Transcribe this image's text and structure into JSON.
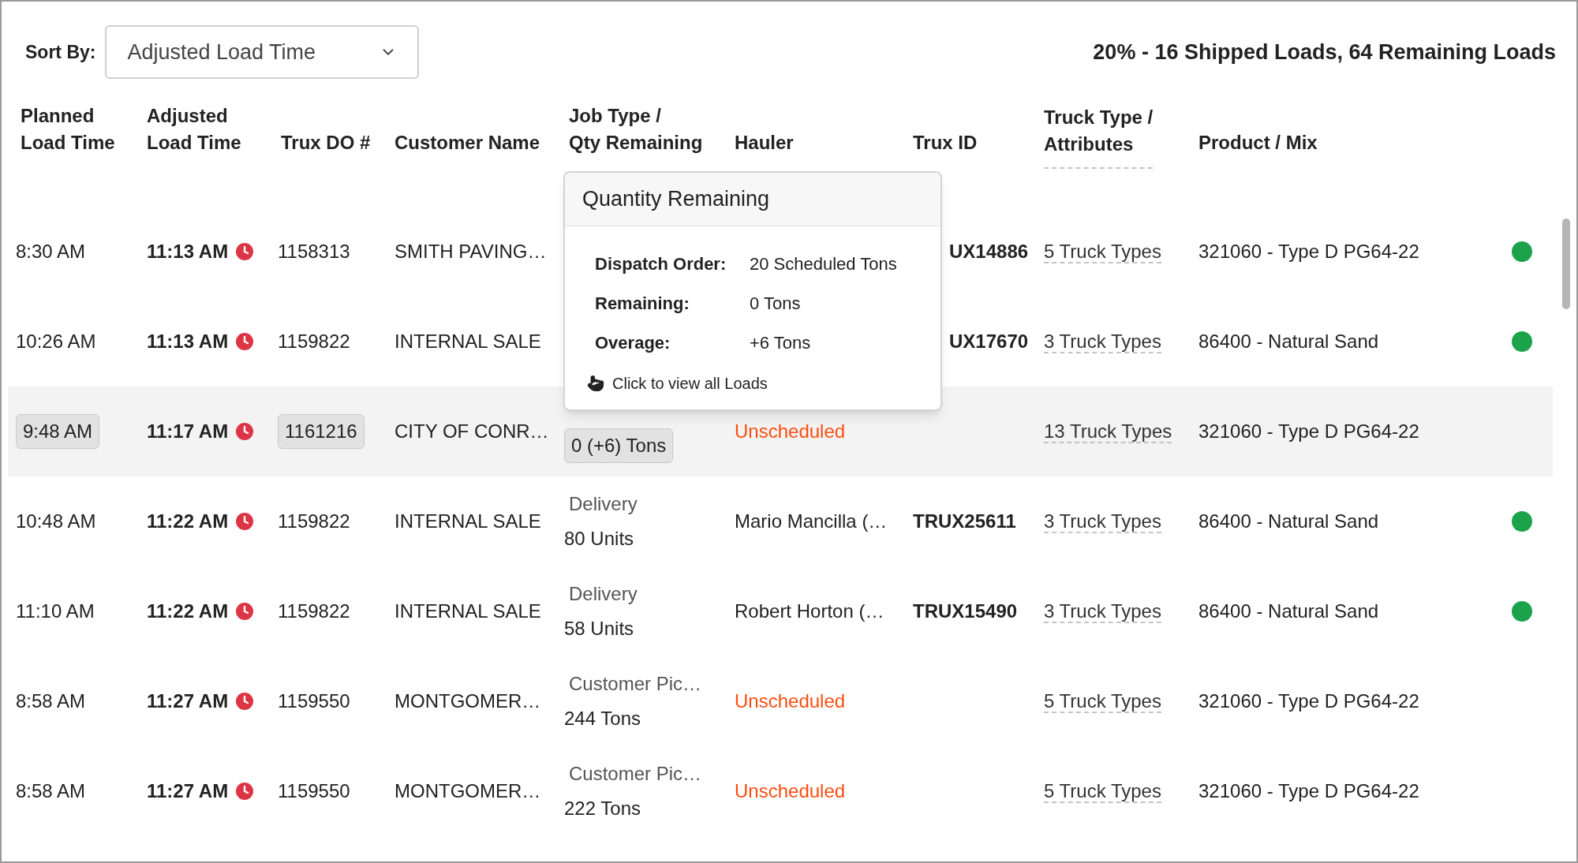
{
  "sort": {
    "label": "Sort By:",
    "value": "Adjusted Load Time"
  },
  "summary": "20% - 16 Shipped Loads, 64 Remaining Loads",
  "columns": [
    {
      "lines": [
        "Planned",
        "Load Time"
      ]
    },
    {
      "lines": [
        "Adjusted",
        "Load Time"
      ]
    },
    {
      "lines": [
        "Trux DO #"
      ]
    },
    {
      "lines": [
        "Customer Name"
      ]
    },
    {
      "lines": [
        "Job Type /",
        "Qty Remaining"
      ]
    },
    {
      "lines": [
        "Hauler"
      ]
    },
    {
      "lines": [
        "Trux ID"
      ]
    },
    {
      "lines": [
        "Truck Type /",
        "Attributes"
      ],
      "dashed": true
    },
    {
      "lines": [
        "Product / Mix"
      ]
    }
  ],
  "rows": [
    {
      "selected": false,
      "planned": "8:30 AM",
      "adjusted": "11:13 AM",
      "do": "1158313",
      "customer": "SMITH PAVING…",
      "trux_id": "UX14886",
      "truck_types": "5 Truck Types",
      "product": "321060 - Type D PG64-22",
      "color": "#1aa34a"
    },
    {
      "selected": false,
      "planned": "10:26 AM",
      "adjusted": "11:13 AM",
      "do": "1159822",
      "customer": "INTERNAL SALE",
      "trux_id": "UX17670",
      "truck_types": "3 Truck Types",
      "product": "86400 - Natural Sand",
      "color": "#1aa34a"
    },
    {
      "selected": true,
      "planned": "9:48 AM",
      "adjusted": "11:17 AM",
      "do": "1161216",
      "customer": "CITY OF CONR…",
      "qty": "0 (+6) Tons",
      "hauler": {
        "kind": "unscheduled",
        "text": "Unscheduled"
      },
      "truck_types": "13 Truck Types",
      "product": "321060 - Type D PG64-22"
    },
    {
      "selected": false,
      "planned": "10:48 AM",
      "adjusted": "11:22 AM",
      "do": "1159822",
      "customer": "INTERNAL SALE",
      "job_type": "Delivery",
      "qty": "80 Units",
      "hauler": {
        "kind": "driver",
        "text": "Mario Mancilla (…"
      },
      "trux_id": "TRUX25611",
      "truck_types": "3 Truck Types",
      "product": "86400 - Natural Sand",
      "color": "#1aa34a"
    },
    {
      "selected": false,
      "planned": "11:10 AM",
      "adjusted": "11:22 AM",
      "do": "1159822",
      "customer": "INTERNAL SALE",
      "job_type": "Delivery",
      "qty": "58 Units",
      "hauler": {
        "kind": "driver",
        "text": "Robert Horton (…"
      },
      "trux_id": "TRUX15490",
      "truck_types": "3 Truck Types",
      "product": "86400 - Natural Sand",
      "color": "#1aa34a"
    },
    {
      "selected": false,
      "planned": "8:58 AM",
      "adjusted": "11:27 AM",
      "do": "1159550",
      "customer": "MONTGOMER…",
      "job_type": "Customer Pic…",
      "qty": "244 Tons",
      "hauler": {
        "kind": "unscheduled",
        "text": "Unscheduled"
      },
      "truck_types": "5 Truck Types",
      "product": "321060 - Type D PG64-22"
    },
    {
      "selected": false,
      "planned": "8:58 AM",
      "adjusted": "11:27 AM",
      "do": "1159550",
      "customer": "MONTGOMER…",
      "job_type": "Customer Pic…",
      "qty": "222 Tons",
      "hauler": {
        "kind": "unscheduled",
        "text": "Unscheduled"
      },
      "truck_types": "5 Truck Types",
      "product": "321060 - Type D PG64-22"
    }
  ],
  "popover": {
    "title": "Quantity Remaining",
    "items": [
      {
        "label": "Dispatch Order:",
        "value": "20 Scheduled Tons"
      },
      {
        "label": "Remaining:",
        "value": "0 Tons"
      },
      {
        "label": "Overage:",
        "value": "+6 Tons"
      }
    ],
    "link": "Click to view all Loads"
  }
}
